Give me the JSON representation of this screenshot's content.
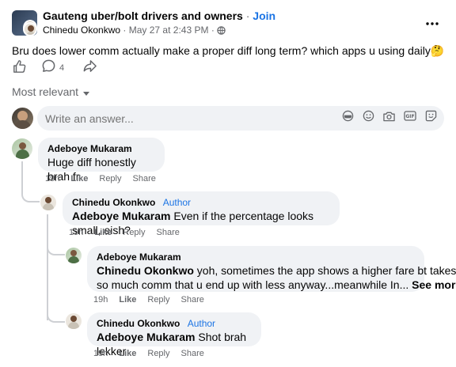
{
  "post": {
    "group_name": "Gauteng uber/bolt drivers and owners",
    "separator": "·",
    "join_label": "Join",
    "author": "Chinedu Okonkwo",
    "date": "May 27 at 2:43 PM",
    "dot": "·",
    "body": "Bru does lower comm actually make a proper diff long term? which apps u using daily🤔",
    "comment_count": "4",
    "more_icon": "more-horizontal-icon"
  },
  "comments_header": {
    "sort_label": "Most relevant"
  },
  "composer": {
    "placeholder": "Write an answer..."
  },
  "comments": [
    {
      "name": "Adeboye Mukaram",
      "text": "Huge diff honestly brah fr",
      "time": "19h",
      "like": "Like",
      "reply": "Reply",
      "share": "Share"
    },
    {
      "name": "Chinedu Okonkwo",
      "author_tag": "Author",
      "mention": "Adeboye Mukaram",
      "text": " Even if the percentage looks small, eish?",
      "time": "19h",
      "like": "Like",
      "reply": "Reply",
      "share": "Share"
    },
    {
      "name": "Adeboye Mukaram",
      "mention": "Chinedu Okonkwo",
      "text_line1": " yoh, sometimes the app shows a higher fare bt takes",
      "text_line2": "so much comm that u end up with less anyway...meanwhile In...",
      "see_more": "See more",
      "time": "19h",
      "like": "Like",
      "reply": "Reply",
      "share": "Share"
    },
    {
      "name": "Chinedu Okonkwo",
      "author_tag": "Author",
      "mention": "Adeboye Mukaram",
      "text": " Shot brah lekker",
      "time": "19h",
      "like": "Like",
      "reply": "Reply",
      "share": "Share"
    }
  ]
}
